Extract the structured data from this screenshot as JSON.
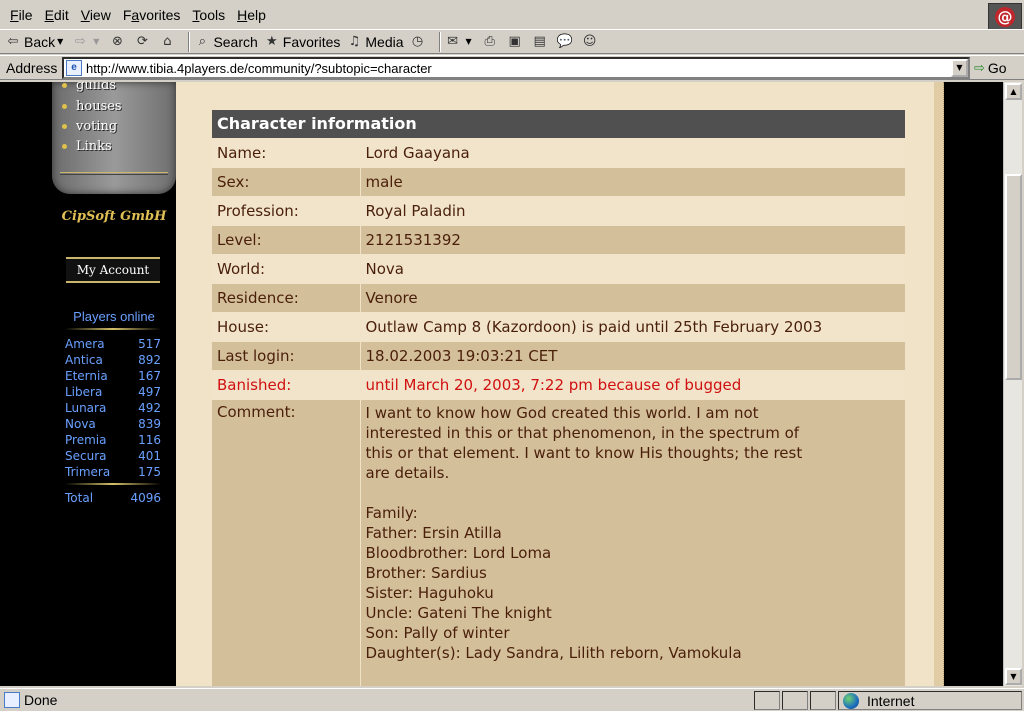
{
  "menubar": {
    "items": [
      {
        "label": "File",
        "u": "F",
        "rest": "ile"
      },
      {
        "label": "Edit",
        "u": "E",
        "rest": "dit"
      },
      {
        "label": "View",
        "u": "V",
        "rest": "iew"
      },
      {
        "label": "Favorites",
        "u": "a",
        "pre": "F",
        "rest": "vorites"
      },
      {
        "label": "Tools",
        "u": "T",
        "rest": "ools"
      },
      {
        "label": "Help",
        "u": "H",
        "rest": "elp"
      }
    ]
  },
  "toolbar": {
    "back_label": "Back",
    "search_label": "Search",
    "favorites_label": "Favorites",
    "media_label": "Media"
  },
  "address": {
    "label": "Address",
    "url": "http://www.tibia.4players.de/community/?subtopic=character",
    "go_label": "Go"
  },
  "sidebar": {
    "menu_items": [
      "guilds",
      "houses",
      "voting",
      "Links"
    ],
    "company": "CipSoft GmbH",
    "account_button": "My Account",
    "players_online_title": "Players online",
    "worlds": [
      {
        "name": "Amera",
        "count": "517"
      },
      {
        "name": "Antica",
        "count": "892"
      },
      {
        "name": "Eternia",
        "count": "167"
      },
      {
        "name": "Libera",
        "count": "497"
      },
      {
        "name": "Lunara",
        "count": "492"
      },
      {
        "name": "Nova",
        "count": "839"
      },
      {
        "name": "Premia",
        "count": "116"
      },
      {
        "name": "Secura",
        "count": "401"
      },
      {
        "name": "Trimera",
        "count": "175"
      }
    ],
    "total_label": "Total",
    "total_count": "4096"
  },
  "character": {
    "header": "Character information",
    "rows": [
      {
        "label": "Name:",
        "value": "Lord Gaayana"
      },
      {
        "label": "Sex:",
        "value": "male"
      },
      {
        "label": "Profession:",
        "value": "Royal Paladin"
      },
      {
        "label": "Level:",
        "value": "2121531392"
      },
      {
        "label": "World:",
        "value": "Nova"
      },
      {
        "label": "Residence:",
        "value": "Venore"
      },
      {
        "label": "House:",
        "value": "Outlaw Camp 8 (Kazordoon) is paid until 25th February 2003"
      },
      {
        "label": "Last login:",
        "value": "18.02.2003 19:03:21 CET"
      },
      {
        "label": "Banished:",
        "value": "until March 20, 2003, 7:22 pm because of bugged"
      }
    ],
    "comment_label": "Comment:",
    "comment": "I want to know how God created this world. I am not\ninterested in this or that phenomenon, in the spectrum of\nthis or that element. I want to know His thoughts; the rest\nare details.\n\nFamily:\nFather: Ersin Atilla\nBloodbrother: Lord Loma\nBrother: Sardius\nSister: Haguhoku\nUncle: Gateni The knight\nSon: Pally of winter\nDaughter(s): Lady Sandra, Lilith reborn, Vamokula"
  },
  "status": {
    "text": "Done",
    "zone": "Internet"
  }
}
